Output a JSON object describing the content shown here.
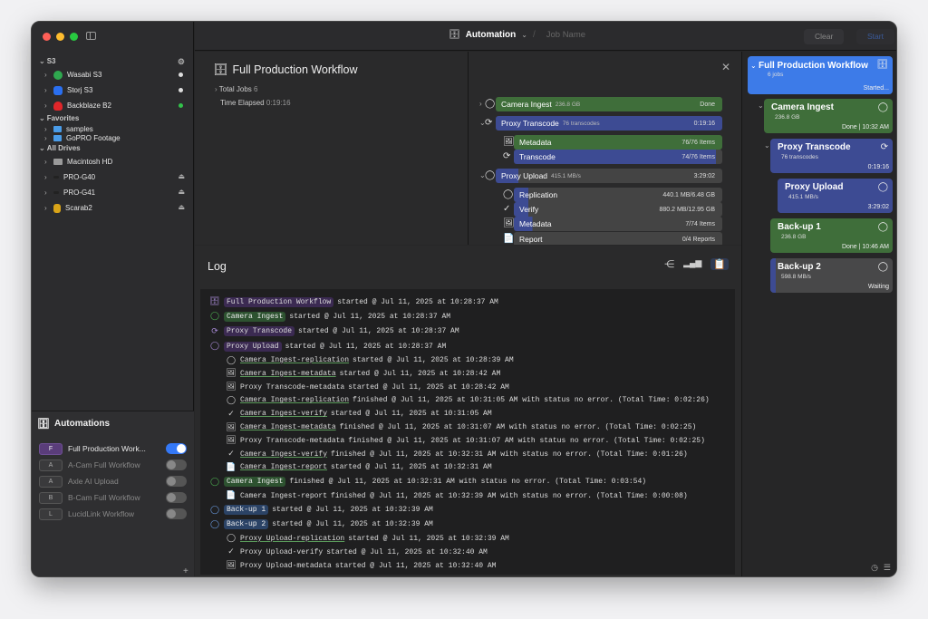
{
  "toolbar": {
    "app_label": "Automation",
    "job_placeholder": "Job Name",
    "clear_label": "Clear",
    "start_label": "Start"
  },
  "sidebar": {
    "s3_label": "S3",
    "s3_items": [
      {
        "label": "Wasabi S3",
        "color": "#2fa84f"
      },
      {
        "label": "Storj S3",
        "color": "#2a6ff0"
      },
      {
        "label": "Backblaze B2",
        "color": "#e0262a"
      }
    ],
    "favorites_label": "Favorites",
    "favorites": [
      {
        "label": "samples"
      },
      {
        "label": "GoPRO Footage"
      }
    ],
    "drives_label": "All Drives",
    "drives": [
      {
        "label": "Macintosh HD"
      },
      {
        "label": "PRO-G40"
      },
      {
        "label": "PRO-G41"
      },
      {
        "label": "Scarab2"
      }
    ]
  },
  "automations": {
    "title": "Automations",
    "items": [
      {
        "letter": "F",
        "label": "Full Production Work...",
        "on": true
      },
      {
        "letter": "A",
        "label": "A-Cam Full Workflow",
        "on": false
      },
      {
        "letter": "A",
        "label": "Axle AI Upload",
        "on": false
      },
      {
        "letter": "B",
        "label": "B-Cam Full Workflow",
        "on": false
      },
      {
        "letter": "L",
        "label": "LucidLink Workflow",
        "on": false
      }
    ]
  },
  "workflow": {
    "title": "Full Production Workflow",
    "total_jobs_label": "Total Jobs",
    "total_jobs": "6",
    "elapsed_label": "Time Elapsed",
    "elapsed": "0:19:16"
  },
  "stages": [
    {
      "label": "Camera Ingest",
      "sub": "236.8 GB",
      "right": "Done",
      "color": "#3f6e3a",
      "fill": 1.0
    },
    {
      "label": "Proxy Transcode",
      "sub": "76 transcodes",
      "right": "0:19:16",
      "color": "#3d4b93",
      "fill": 1.0
    },
    {
      "label": "Metadata",
      "sub": "",
      "right": "76/76 Items",
      "color": "#3f6e3a",
      "fill": 1.0
    },
    {
      "label": "Transcode",
      "sub": "",
      "right": "74/76 Items",
      "color": "#3d4b93",
      "fill": 0.97
    },
    {
      "label": "Proxy Upload",
      "sub": "415.1 MB/s",
      "right": "3:29:02",
      "color": "#3d4b93",
      "fill": 0.1
    },
    {
      "label": "Replication",
      "sub": "",
      "right": "440.1 MB/6.48 GB",
      "color": "#3d4b93",
      "fill": 0.07
    },
    {
      "label": "Verify",
      "sub": "",
      "right": "880.2 MB/12.95 GB",
      "color": "#3d4b93",
      "fill": 0.07
    },
    {
      "label": "Metadata",
      "sub": "",
      "right": "7/74 Items",
      "color": "#3d4b93",
      "fill": 0.09
    },
    {
      "label": "Report",
      "sub": "",
      "right": "0/4 Reports",
      "color": "#3d4b93",
      "fill": 0.0
    }
  ],
  "log": {
    "title": "Log",
    "lines": [
      {
        "tag": "Full Production Workflow",
        "text": "started @ Jul 11, 2025 at 10:28:37 AM"
      },
      {
        "tag": "Camera Ingest",
        "text": "started @ Jul 11, 2025 at 10:28:37 AM"
      },
      {
        "tag": "Proxy Transcode",
        "text": "started @ Jul 11, 2025 at 10:28:37 AM"
      },
      {
        "tag": "Proxy Upload",
        "text": "started @ Jul 11, 2025 at 10:28:37 AM"
      },
      {
        "tag": "Camera Ingest-replication",
        "text": "started @ Jul 11, 2025 at 10:28:39 AM"
      },
      {
        "tag": "Camera Ingest-metadata",
        "text": "started @ Jul 11, 2025 at 10:28:42 AM"
      },
      {
        "tag": "Proxy Transcode-metadata",
        "text": "started @ Jul 11, 2025 at 10:28:42 AM"
      },
      {
        "tag": "Camera Ingest-replication",
        "text": "finished @ Jul 11, 2025 at 10:31:05 AM with status no error. (Total Time: 0:02:26)"
      },
      {
        "tag": "Camera Ingest-verify",
        "text": "started @ Jul 11, 2025 at 10:31:05 AM"
      },
      {
        "tag": "Camera Ingest-metadata",
        "text": "finished @ Jul 11, 2025 at 10:31:07 AM with status no error. (Total Time: 0:02:25)"
      },
      {
        "tag": "Proxy Transcode-metadata",
        "text": "finished @ Jul 11, 2025 at 10:31:07 AM with status no error. (Total Time: 0:02:25)"
      },
      {
        "tag": "Camera Ingest-verify",
        "text": "finished @ Jul 11, 2025 at 10:32:31 AM with status no error. (Total Time: 0:01:26)"
      },
      {
        "tag": "Camera Ingest-report",
        "text": "started @ Jul 11, 2025 at 10:32:31 AM"
      },
      {
        "tag": "Camera Ingest",
        "text": "finished @ Jul 11, 2025 at 10:32:31 AM with status no error. (Total Time: 0:03:54)"
      },
      {
        "tag": "Camera Ingest-report",
        "text": "finished @ Jul 11, 2025 at 10:32:39 AM with status no error. (Total Time: 0:00:08)"
      },
      {
        "tag": "Back-up 1",
        "text": "started @ Jul 11, 2025 at 10:32:39 AM"
      },
      {
        "tag": "Back-up 2",
        "text": "started @ Jul 11, 2025 at 10:32:39 AM"
      },
      {
        "tag": "Proxy Upload-replication",
        "text": "started @ Jul 11, 2025 at 10:32:39 AM"
      },
      {
        "tag": "Proxy Upload-verify",
        "text": "started @ Jul 11, 2025 at 10:32:40 AM"
      },
      {
        "tag": "Proxy Upload-metadata",
        "text": "started @ Jul 11, 2025 at 10:32:40 AM"
      }
    ]
  },
  "jobs": {
    "main": {
      "title": "Full Production Workflow",
      "sub": "6 jobs",
      "status": "Started..."
    },
    "cards": [
      {
        "title": "Camera Ingest",
        "sub": "236.8 GB",
        "status": "Done | 10:32 AM",
        "color": "#3f6e3a"
      },
      {
        "title": "Proxy Transcode",
        "sub": "76 transcodes",
        "status": "0:19:16",
        "color": "#3d4b93"
      },
      {
        "title": "Proxy Upload",
        "sub": "415.1 MB/s",
        "status": "3:29:02",
        "color": "#3d4b93"
      },
      {
        "title": "Back-up 1",
        "sub": "236.8 GB",
        "status": "Done | 10:46 AM",
        "color": "#3f6e3a"
      },
      {
        "title": "Back-up 2",
        "sub": "598.8 MB/s",
        "status": "Waiting",
        "color": "#484849"
      }
    ]
  }
}
